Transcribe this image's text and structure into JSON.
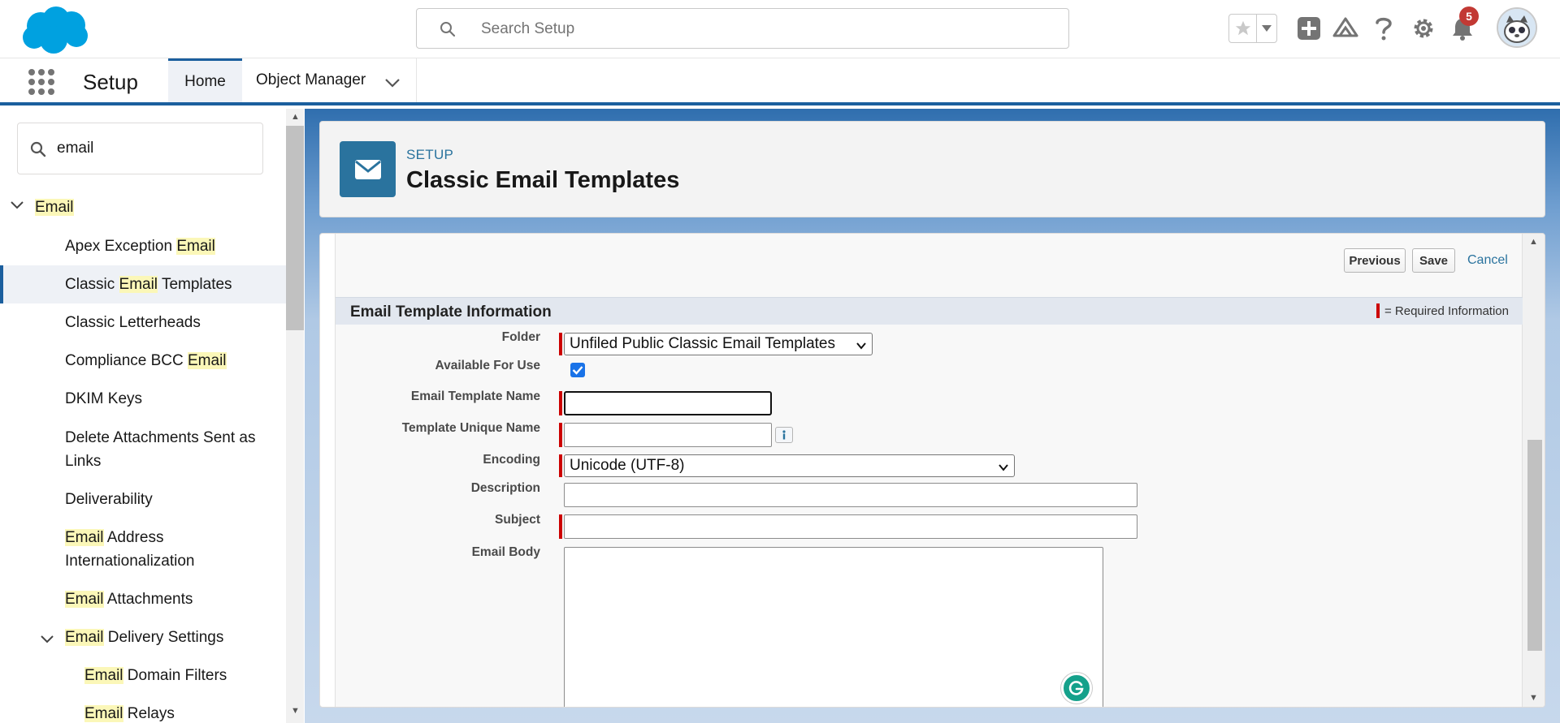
{
  "global_header": {
    "search_placeholder": "Search Setup",
    "notification_count": "5",
    "icons": [
      "salesforce-cloud-logo",
      "search-icon",
      "star-icon",
      "chevron-down-icon",
      "plus-icon",
      "trailhead-icon",
      "help-icon",
      "gear-icon",
      "bell-icon",
      "user-avatar"
    ]
  },
  "context_bar": {
    "app_name": "Setup",
    "tabs": [
      {
        "label": "Home",
        "active": true
      },
      {
        "label": "Object Manager",
        "active": false
      }
    ]
  },
  "sidebar": {
    "quick_find_value": "email",
    "items": [
      {
        "pre": "",
        "hl": "Email",
        "post": ""
      },
      {
        "pre": "Apex Exception ",
        "hl": "Email",
        "post": ""
      },
      {
        "pre": "Classic ",
        "hl": "Email",
        "post": " Templates"
      },
      {
        "pre": "Classic Letterheads",
        "hl": "",
        "post": ""
      },
      {
        "pre": "Compliance BCC ",
        "hl": "Email",
        "post": ""
      },
      {
        "pre": "DKIM Keys",
        "hl": "",
        "post": ""
      },
      {
        "line1": "Delete Attachments Sent as",
        "line2": "Links"
      },
      {
        "pre": "Deliverability",
        "hl": "",
        "post": ""
      },
      {
        "line1_hl": "Email",
        "line1_post": " Address",
        "line2": "Internationalization"
      },
      {
        "pre": "",
        "hl": "Email",
        "post": " Attachments"
      },
      {
        "pre": "",
        "hl": "Email",
        "post": " Delivery Settings"
      },
      {
        "pre": "",
        "hl": "Email",
        "post": " Domain Filters"
      },
      {
        "pre": "",
        "hl": "Email",
        "post": " Relays"
      }
    ]
  },
  "page_header": {
    "kicker": "SETUP",
    "title": "Classic Email Templates"
  },
  "form": {
    "buttons": {
      "previous": "Previous",
      "save": "Save",
      "cancel": "Cancel"
    },
    "section_title": "Email Template Information",
    "required_legend": "= Required Information",
    "fields": {
      "folder": {
        "label": "Folder",
        "value": "Unfiled Public Classic Email Templates"
      },
      "available": {
        "label": "Available For Use",
        "checked": true
      },
      "name": {
        "label": "Email Template Name",
        "value": ""
      },
      "unique_name": {
        "label": "Template Unique Name",
        "value": ""
      },
      "encoding": {
        "label": "Encoding",
        "value": "Unicode (UTF-8)"
      },
      "description": {
        "label": "Description",
        "value": ""
      },
      "subject": {
        "label": "Subject",
        "value": ""
      },
      "body": {
        "label": "Email Body",
        "value": ""
      }
    }
  },
  "colors": {
    "brand_blue": "#1b5f9e",
    "required_red": "#c00",
    "highlight_yellow": "#fbf7b8",
    "icon_teal": "#2a739e"
  }
}
